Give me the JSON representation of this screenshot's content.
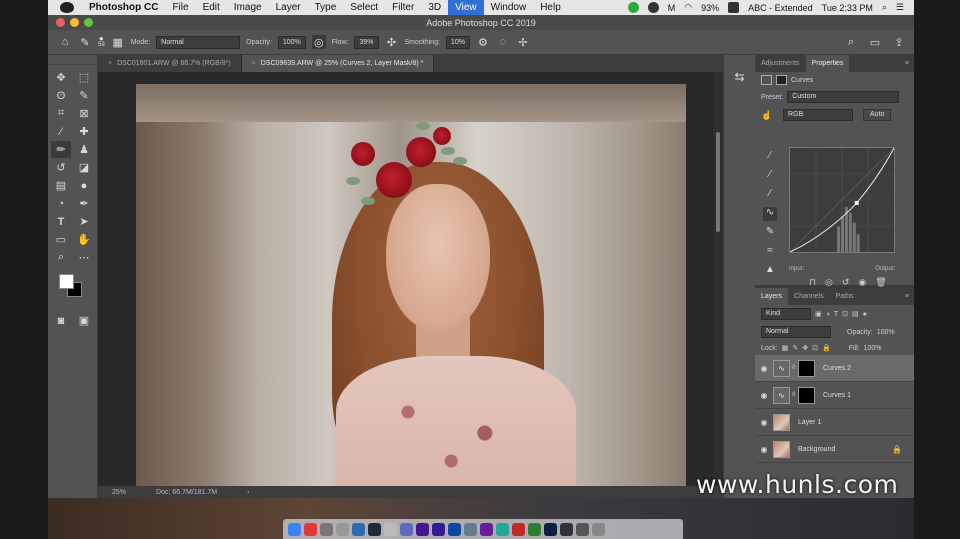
{
  "menubar": {
    "app_name": "Photoshop CC",
    "items": [
      "File",
      "Edit",
      "Image",
      "Layer",
      "Type",
      "Select",
      "Filter",
      "3D",
      "View",
      "Window",
      "Help"
    ],
    "active_item": "View",
    "battery": "93%",
    "input_source": "ABC - Extended",
    "clock": "Tue 2:33 PM"
  },
  "window": {
    "title": "Adobe Photoshop CC 2019"
  },
  "options_bar": {
    "brush_size": "59",
    "mode_label": "Mode:",
    "mode_value": "Normal",
    "opacity_label": "Opacity:",
    "opacity_value": "100%",
    "flow_label": "Flow:",
    "flow_value": "39%",
    "smoothing_label": "Smoothing:",
    "smoothing_value": "10%"
  },
  "tabs": [
    {
      "label": "DSC01801.ARW @ 66.7% (RGB/8*)",
      "active": false
    },
    {
      "label": "DSC09639.ARW @ 25% (Curves 2, Layer Mask/8) *",
      "active": true
    }
  ],
  "status": {
    "zoom": "25%",
    "doc": "Doc: 66.7M/181.7M"
  },
  "properties": {
    "tabs": [
      "Adjustments",
      "Properties"
    ],
    "active_tab": "Properties",
    "title": "Curves",
    "preset_label": "Preset:",
    "preset_value": "Custom",
    "channel": "RGB",
    "auto_label": "Auto",
    "input_label": "Input:",
    "output_label": "Output:"
  },
  "layers_panel": {
    "tabs": [
      "Layers",
      "Channels",
      "Paths"
    ],
    "active_tab": "Layers",
    "filter": "Kind",
    "blend_mode": "Normal",
    "opacity_label": "Opacity:",
    "opacity_value": "100%",
    "lock_label": "Lock:",
    "fill_label": "Fill:",
    "fill_value": "100%",
    "layers": [
      {
        "name": "Curves 2",
        "type": "adjustment",
        "selected": true
      },
      {
        "name": "Curves 1",
        "type": "adjustment",
        "selected": false
      },
      {
        "name": "Layer 1",
        "type": "pixel",
        "selected": false
      },
      {
        "name": "Background",
        "type": "pixel",
        "locked": true,
        "selected": false
      }
    ]
  },
  "watermark": "www.hunls.com",
  "colors": {
    "menu_highlight": "#2f6fd6",
    "panel_bg": "#535353",
    "dark_bg": "#3d3d3d"
  }
}
